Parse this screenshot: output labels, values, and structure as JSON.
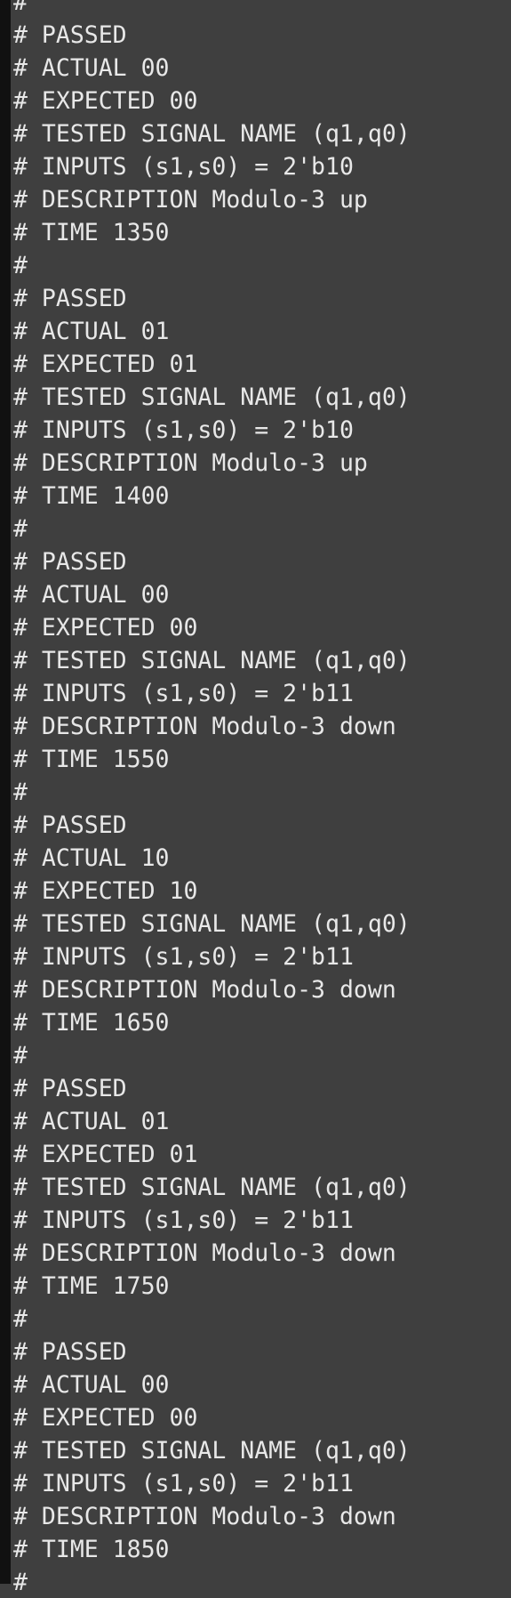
{
  "console": {
    "lines": [
      "#",
      "# PASSED",
      "# ACTUAL 00",
      "# EXPECTED 00",
      "# TESTED SIGNAL NAME (q1,q0)",
      "# INPUTS (s1,s0) = 2'b10",
      "# DESCRIPTION Modulo-3 up",
      "# TIME 1350",
      "#",
      "# PASSED",
      "# ACTUAL 01",
      "# EXPECTED 01",
      "# TESTED SIGNAL NAME (q1,q0)",
      "# INPUTS (s1,s0) = 2'b10",
      "# DESCRIPTION Modulo-3 up",
      "# TIME 1400",
      "#",
      "# PASSED",
      "# ACTUAL 00",
      "# EXPECTED 00",
      "# TESTED SIGNAL NAME (q1,q0)",
      "# INPUTS (s1,s0) = 2'b11",
      "# DESCRIPTION Modulo-3 down",
      "# TIME 1550",
      "#",
      "# PASSED",
      "# ACTUAL 10",
      "# EXPECTED 10",
      "# TESTED SIGNAL NAME (q1,q0)",
      "# INPUTS (s1,s0) = 2'b11",
      "# DESCRIPTION Modulo-3 down",
      "# TIME 1650",
      "#",
      "# PASSED",
      "# ACTUAL 01",
      "# EXPECTED 01",
      "# TESTED SIGNAL NAME (q1,q0)",
      "# INPUTS (s1,s0) = 2'b11",
      "# DESCRIPTION Modulo-3 down",
      "# TIME 1750",
      "#",
      "# PASSED",
      "# ACTUAL 00",
      "# EXPECTED 00",
      "# TESTED SIGNAL NAME (q1,q0)",
      "# INPUTS (s1,s0) = 2'b11",
      "# DESCRIPTION Modulo-3 down",
      "# TIME 1850",
      "#"
    ]
  }
}
